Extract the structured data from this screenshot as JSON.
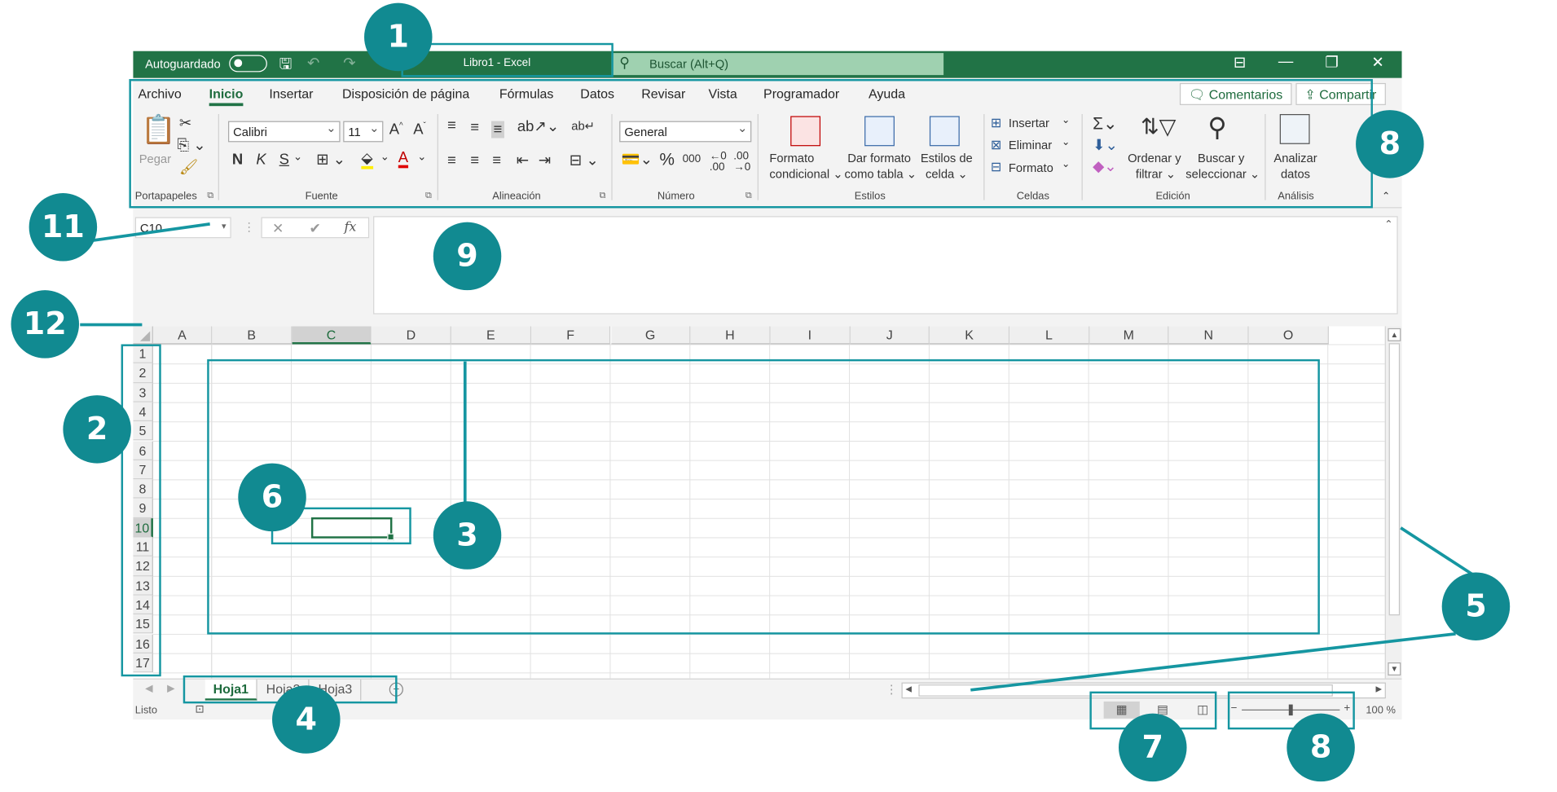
{
  "app": {
    "autosave_label": "Autoguardado",
    "window_title": "Libro1  -  Excel",
    "search_placeholder": "Buscar (Alt+Q)"
  },
  "ribbon": {
    "tabs": [
      "Archivo",
      "Inicio",
      "Insertar",
      "Disposición de página",
      "Fórmulas",
      "Datos",
      "Revisar",
      "Vista",
      "Programador",
      "Ayuda"
    ],
    "active_tab": "Inicio",
    "comments_button": "Comentarios",
    "share_button": "Compartir",
    "groups": {
      "clipboard": {
        "label": "Portapapeles",
        "paste": "Pegar"
      },
      "font": {
        "label": "Fuente",
        "font_name": "Calibri",
        "font_size": "11",
        "bold": "N",
        "italic": "K",
        "underline": "S"
      },
      "alignment": {
        "label": "Alineación"
      },
      "number": {
        "label": "Número",
        "format": "General",
        "percent": "%",
        "thousands": "000"
      },
      "styles": {
        "label": "Estilos",
        "conditional_1": "Formato",
        "conditional_2": "condicional ⌄",
        "table_1": "Dar formato",
        "table_2": "como tabla ⌄",
        "cell_1": "Estilos de",
        "cell_2": "celda ⌄"
      },
      "cells": {
        "label": "Celdas",
        "insert": "Insertar",
        "delete": "Eliminar",
        "format": "Formato"
      },
      "editing": {
        "label": "Edición",
        "sort_1": "Ordenar y",
        "sort_2": "filtrar ⌄",
        "find_1": "Buscar y",
        "find_2": "seleccionar ⌄"
      },
      "analysis": {
        "label": "Análisis",
        "analyze_1": "Analizar",
        "analyze_2": "datos"
      }
    }
  },
  "formula_bar": {
    "name_box": "C10",
    "cancel": "✕",
    "enter": "✔",
    "fx": "fx",
    "value": ""
  },
  "grid": {
    "columns": [
      "A",
      "B",
      "C",
      "D",
      "E",
      "F",
      "G",
      "H",
      "I",
      "J",
      "K",
      "L",
      "M",
      "N",
      "O"
    ],
    "rows": [
      "1",
      "2",
      "3",
      "4",
      "5",
      "6",
      "7",
      "8",
      "9",
      "10",
      "11",
      "12",
      "13",
      "14",
      "15",
      "16",
      "17"
    ],
    "selected_column": "C",
    "selected_row": "10"
  },
  "sheets": {
    "tabs": [
      "Hoja1",
      "Hoja2",
      "Hoja3"
    ],
    "active": "Hoja1",
    "add": "+"
  },
  "status": {
    "ready": "Listo",
    "zoom": "100 %"
  },
  "annotations": [
    "1",
    "2",
    "3",
    "4",
    "5",
    "6",
    "7",
    "8",
    "8",
    "9",
    "11",
    "12"
  ],
  "colors": {
    "excel_green": "#217346",
    "annotation_teal": "#1596a1"
  }
}
